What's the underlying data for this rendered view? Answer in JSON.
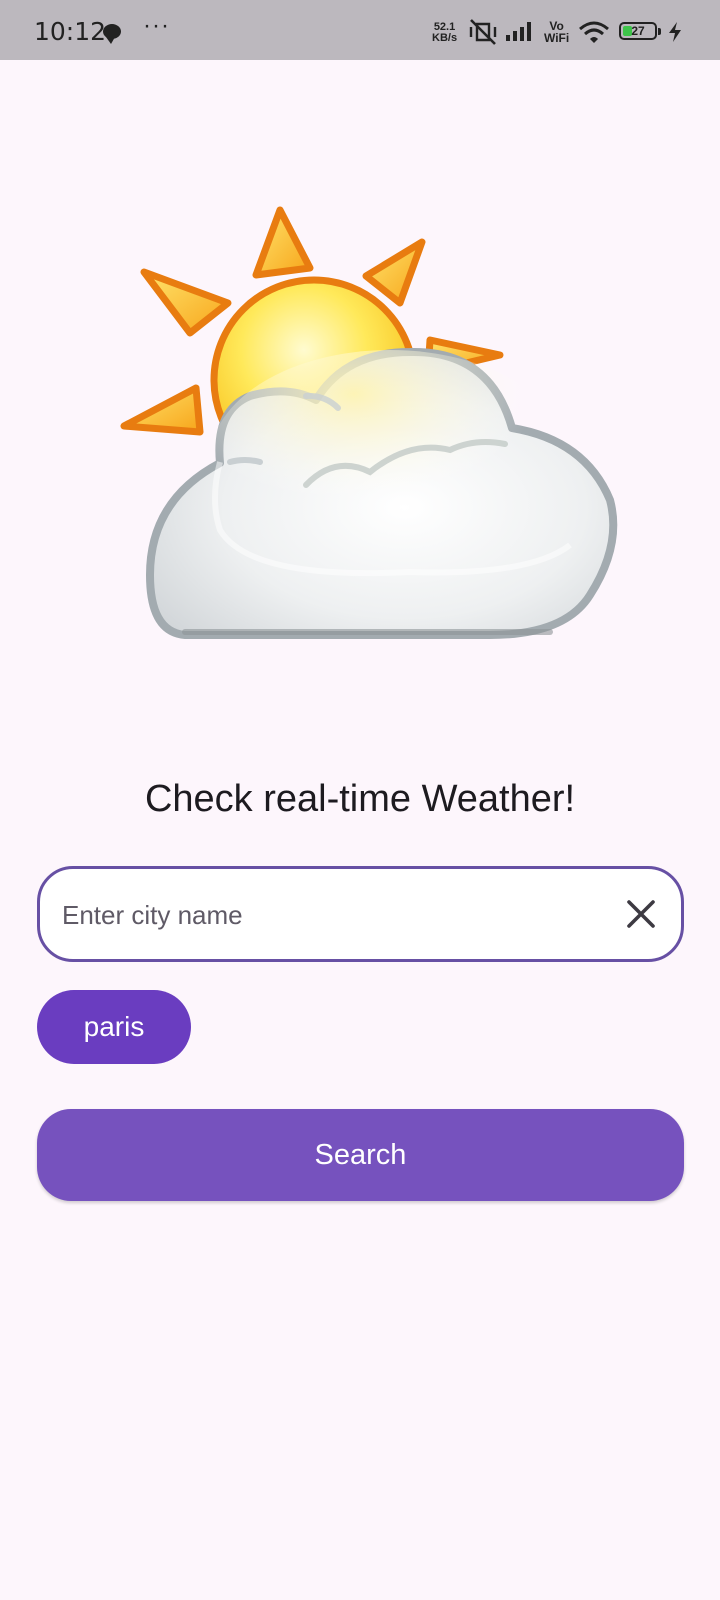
{
  "status_bar": {
    "time": "10:12",
    "more": "···",
    "net_speed_value": "52.1",
    "net_speed_unit": "KB/s",
    "vo": "Vo",
    "wifi_label": "WiFi",
    "battery_level": "27",
    "battery_color": "#3ec54a"
  },
  "main": {
    "illustration_icon": "partly-cloudy-icon",
    "title": "Check real-time Weather!",
    "search": {
      "placeholder": "Enter city name",
      "value": "",
      "clear_icon": "close-icon"
    },
    "recent_chips": [
      {
        "label": "paris"
      }
    ],
    "search_button_label": "Search"
  },
  "colors": {
    "accent": "#6750a4",
    "chip": "#6a3dc0",
    "button": "#7652be",
    "background": "#fdf6fc"
  }
}
